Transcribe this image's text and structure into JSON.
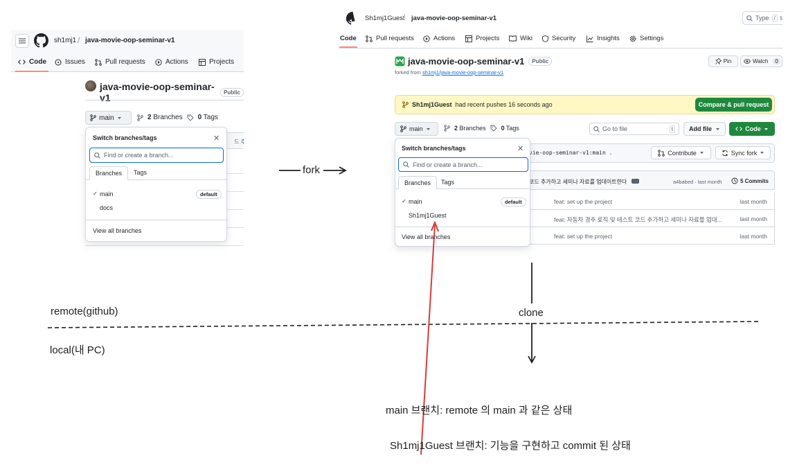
{
  "left": {
    "user": "sh1mj1",
    "separator": "/",
    "repo": "java-movie-oop-seminar-v1",
    "tabs": [
      "Code",
      "Issues",
      "Pull requests",
      "Actions",
      "Projects"
    ],
    "repo_title": "java-movie-oop-seminar-v1",
    "visibility": "Public",
    "branch_button": "main",
    "branches_count": "2",
    "branches_label": "Branches",
    "tags_count": "0",
    "tags_label": "Tags",
    "commit_strip_text": "드 추가",
    "dropdown": {
      "title": "Switch branches/tags",
      "close": "✕",
      "placeholder": "Find or create a branch...",
      "tab_branches": "Branches",
      "tab_tags": "Tags",
      "items": [
        {
          "name": "main",
          "checked": true,
          "badge": "default"
        },
        {
          "name": "docs",
          "checked": false,
          "badge": ""
        }
      ],
      "view_all": "View all branches"
    }
  },
  "right": {
    "user": "Sh1mj1Guest",
    "separator": "/",
    "repo": "java-movie-oop-seminar-v1",
    "search_text": "Type",
    "search_key": "/",
    "search_suffix": "to",
    "tabs": [
      "Code",
      "Pull requests",
      "Actions",
      "Projects",
      "Wiki",
      "Security",
      "Insights",
      "Settings"
    ],
    "repo_title": "java-movie-oop-seminar-v1",
    "visibility": "Public",
    "forked_prefix": "forked from",
    "forked_link": "sh1mj1/java-movie-oop-seminar-v1",
    "pin_label": "Pin",
    "watch_label": "Watch",
    "watch_count": "0",
    "banner_user": "Sh1mj1Guest",
    "banner_text": "had recent pushes 16 seconds ago",
    "compare_button": "Compare & pull request",
    "branch_button": "main",
    "branches_count": "2",
    "branches_label": "Branches",
    "tags_count": "0",
    "tags_label": "Tags",
    "goto_placeholder": "Go to file",
    "goto_key": "t",
    "add_file": "Add file",
    "code_button": "Code",
    "compare_strip_text": "vie-oop-seminar-v1:main .",
    "contribute": "Contribute",
    "sync_fork": "Sync fork",
    "head_message": "코드 추가하고 세미나 자료를 업데이트한다",
    "head_hash": "a4babed · last month",
    "head_commits": "5 Commits",
    "rows": [
      {
        "message": "feat: set up the project",
        "time": "last month"
      },
      {
        "message": "feat: 자동차 경주 로직 및 테스트 코드 추가하고 세미나 자료를 업대...",
        "time": "last month"
      },
      {
        "message": "feat: set up the project",
        "time": "last month"
      }
    ],
    "dropdown": {
      "title": "Switch branches/tags",
      "close": "✕",
      "placeholder": "Find or create a branch...",
      "tab_branches": "Branches",
      "tab_tags": "Tags",
      "items": [
        {
          "name": "main",
          "checked": true,
          "badge": "default"
        },
        {
          "name": "Sh1mj1Guest",
          "checked": false,
          "badge": ""
        }
      ],
      "view_all": "View all branches"
    }
  },
  "annotations": {
    "fork": "fork",
    "remote": "remote(github)",
    "local": "local(내 PC)",
    "clone": "clone",
    "note_main": "main 브랜치: remote 의 main 과 같은 상태",
    "note_guest": "Sh1mj1Guest 브랜치: 기능을 구현하고 commit 된 상태"
  },
  "colors": {
    "accent_green": "#1f883d",
    "tab_underline": "#fd8c73",
    "banner_bg": "#fff8c5",
    "red_arrow": "#d93a3a",
    "link_blue": "#0969da"
  }
}
